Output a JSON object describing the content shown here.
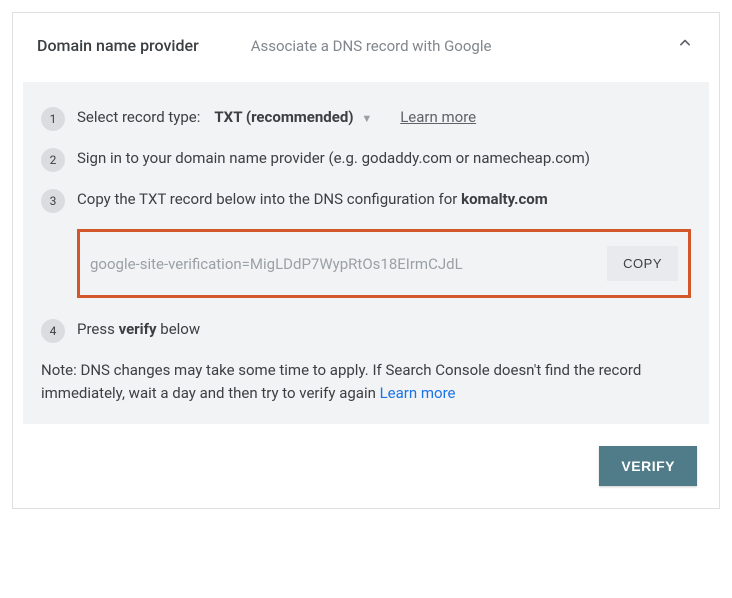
{
  "header": {
    "title": "Domain name provider",
    "subtitle": "Associate a DNS record with Google"
  },
  "steps": {
    "s1": {
      "num": "1",
      "label": "Select record type:",
      "record_type": "TXT (recommended)",
      "learn_more": "Learn more"
    },
    "s2": {
      "num": "2",
      "text": "Sign in to your domain name provider (e.g. godaddy.com or namecheap.com)"
    },
    "s3": {
      "num": "3",
      "text_prefix": "Copy the TXT record below into the DNS configuration for ",
      "domain": "komalty.com",
      "txt_value": "google-site-verification=MigLDdP7WypRtOs18EIrmCJdL",
      "copy_label": "COPY"
    },
    "s4": {
      "num": "4",
      "text_prefix": "Press ",
      "bold_word": "verify",
      "text_suffix": " below"
    }
  },
  "note": {
    "text": "Note: DNS changes may take some time to apply. If Search Console doesn't find the record immediately, wait a day and then try to verify again ",
    "link": "Learn more"
  },
  "verify_label": "VERIFY"
}
